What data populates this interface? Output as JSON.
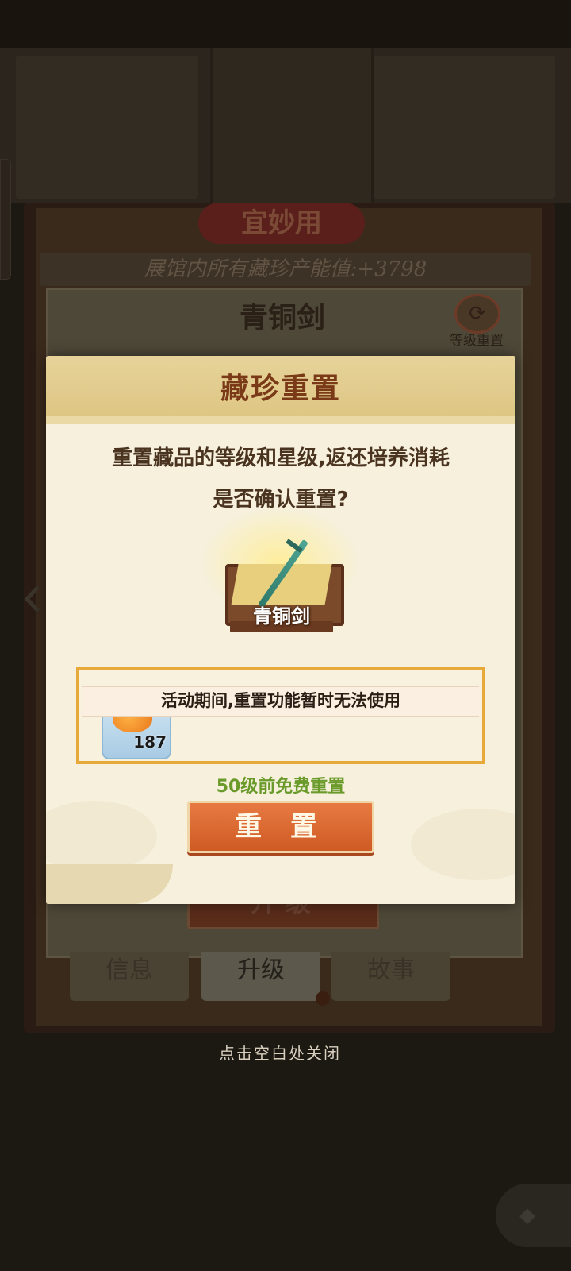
{
  "background": {
    "title": "宜妙用",
    "museum_value_text": "展馆内所有藏珍产能值:+3798",
    "card_title": "青铜剑",
    "reset_icon_label": "等级重置",
    "upgrade_button": "升 级",
    "tabs": [
      {
        "label": "信息"
      },
      {
        "label": "升级"
      },
      {
        "label": "故事"
      }
    ]
  },
  "modal": {
    "title": "藏珍重置",
    "desc_line_1": "重置藏品的等级和星级,返还培养消耗",
    "desc_line_2": "是否确认重置?",
    "item_name": "青铜剑",
    "notice": "活动期间,重置功能暂时无法使用",
    "cost_item_count": "187",
    "free_reset_text": "50级前免费重置",
    "reset_button": "重 置"
  },
  "close_hint": "点击空白处关闭"
}
